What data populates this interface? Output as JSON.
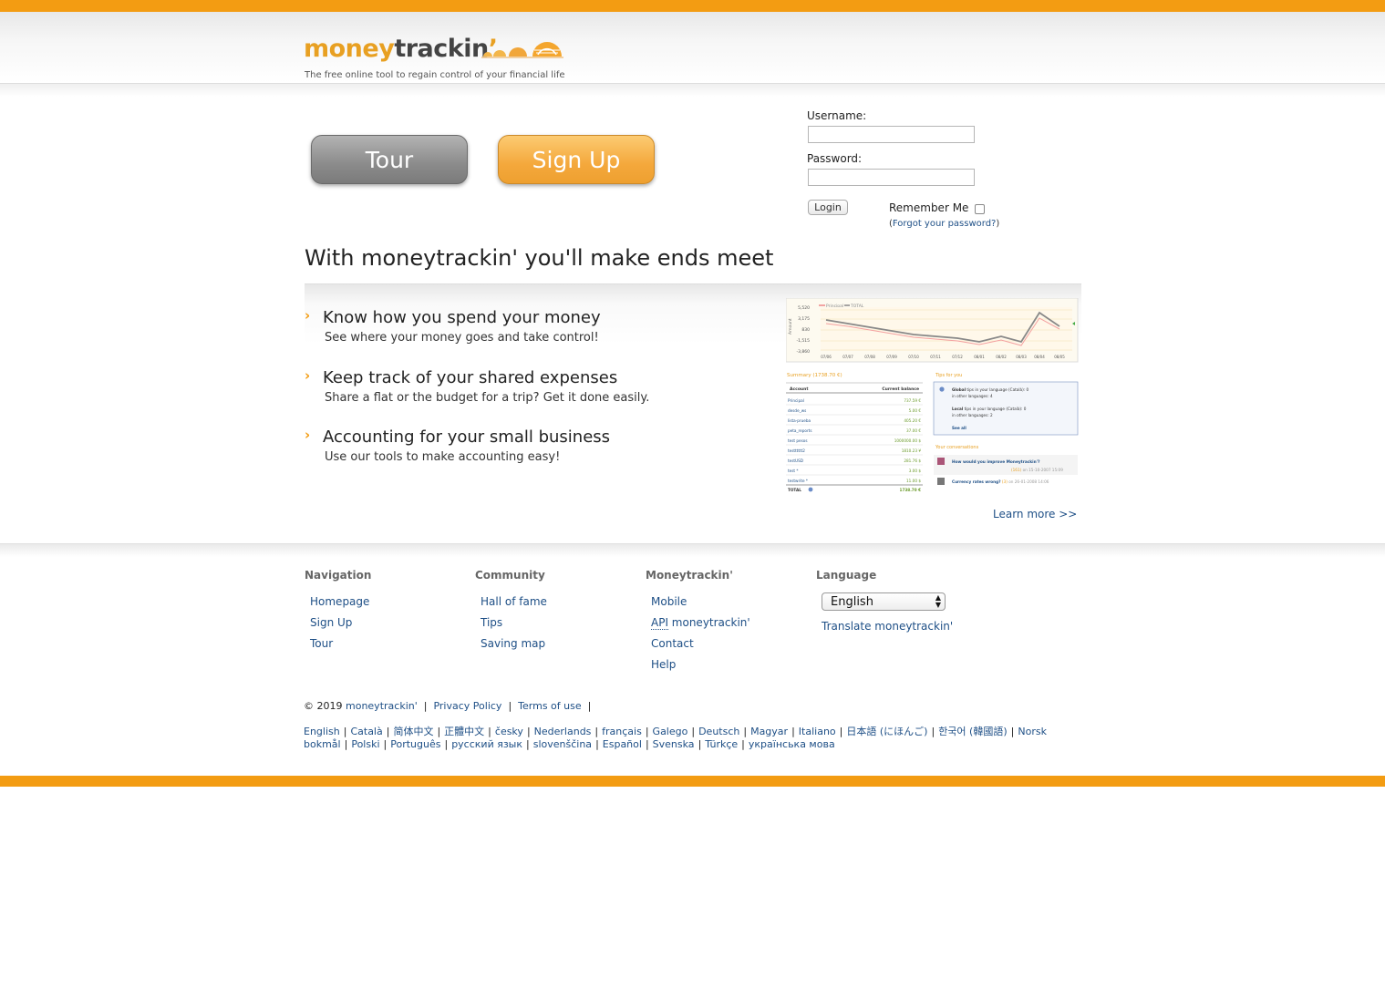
{
  "brand": {
    "logo_money": "money",
    "logo_trackin": "trackin",
    "logo_apos": "’",
    "tagline": "The free online tool to regain control of your financial life"
  },
  "hero": {
    "tour_label": "Tour",
    "signup_label": "Sign Up"
  },
  "login": {
    "username_label": "Username:",
    "username_value": "",
    "password_label": "Password:",
    "password_value": "",
    "login_label": "Login",
    "remember_label": "Remember Me",
    "forgot_open": "(",
    "forgot_link": "Forgot your password?",
    "forgot_close": ")"
  },
  "main": {
    "headline": "With moneytrackin' you'll make ends meet",
    "features": [
      {
        "title": "Know how you spend your money",
        "desc": "See where your money goes and take control!"
      },
      {
        "title": "Keep track of your shared expenses",
        "desc": "Share a flat or the budget for a trip? Get it done easily."
      },
      {
        "title": "Accounting for your small business",
        "desc": "Use our tools to make accounting easy!"
      }
    ],
    "learn_more": "Learn more >>",
    "screenshot": {
      "legend": [
        "Principal",
        "TOTAL"
      ],
      "y_ticks": [
        "5,520",
        "3,175",
        "830",
        "-1,515",
        "-3,860"
      ],
      "x_ticks": [
        "07/06",
        "07/07",
        "07/08",
        "07/09",
        "07/10",
        "07/11",
        "07/12",
        "08/01",
        "08/02",
        "08/03",
        "08/04",
        "08/05"
      ],
      "ylabel": "Amount",
      "summary_title": "Summary (1738.70 €)",
      "tips_title": "Tips for you",
      "col_account": "Account",
      "col_balance": "Current balance",
      "rows": [
        {
          "name": "Principal",
          "value": "737.59 €"
        },
        {
          "name": "desde_ws",
          "value": "5.00 €"
        },
        {
          "name": "lista-prueba",
          "value": "405.20 €"
        },
        {
          "name": "peta_reports",
          "value": "37.00 €"
        },
        {
          "name": "test pesos",
          "value": "1000000.00 $"
        },
        {
          "name": "testttttt2",
          "value": "1810.23 ¥"
        },
        {
          "name": "testUSD",
          "value": "281.76 $"
        },
        {
          "name": "test *",
          "value": "3.00 $"
        },
        {
          "name": "testwrite *",
          "value": "11.00 $"
        }
      ],
      "total_label": "TOTAL",
      "total_value": "1738.70 €",
      "tip_global_bold": "Global",
      "tip_global": " tips in your language (Català): 0",
      "tip_global_other": "in other languages: 4",
      "tip_local_bold": "Local",
      "tip_local": " tips in your language (Català): 0",
      "tip_local_other": "in other languages: 2",
      "see_all": "See all",
      "conv_title": "Your conversations",
      "conv1_link": "How would you improve Moneytrackin'?",
      "conv1_count": "(161)",
      "conv1_date": " on 15-10-2007 15:09",
      "conv2_link": "Currency rates wrong?",
      "conv2_count": "(3)",
      "conv2_date": " on 26-01-2008 14:06"
    }
  },
  "footer": {
    "nav_title": "Navigation",
    "nav_links": [
      "Homepage",
      "Sign Up",
      "Tour"
    ],
    "community_title": "Community",
    "community_links": [
      "Hall of fame",
      "Tips",
      "Saving map"
    ],
    "mt_title": "Moneytrackin'",
    "mt_links": [
      "Mobile",
      "API",
      " moneytrackin'",
      "Contact",
      "Help"
    ],
    "lang_title": "Language",
    "lang_selected": "English",
    "translate_link": "Translate moneytrackin'",
    "copyright": "© 2019",
    "copyright_link": "moneytrackin'",
    "privacy": "Privacy Policy",
    "terms": "Terms of use",
    "languages": [
      "English",
      "Català",
      "简体中文",
      "正體中文",
      "česky",
      "Nederlands",
      "français",
      "Galego",
      "Deutsch",
      "Magyar",
      "Italiano",
      "日本語 (にほんご)",
      "한국어 (韓國語)",
      "Norsk bokmål",
      "Polski",
      "Português",
      "русский язык",
      "slovenščina",
      "Español",
      "Svenska",
      "Türkçe",
      "українська мова"
    ]
  },
  "colors": {
    "accent": "#f39c12",
    "link": "#1e4f86",
    "signup": "#f4a83c",
    "tour": "#8b8b8b"
  }
}
